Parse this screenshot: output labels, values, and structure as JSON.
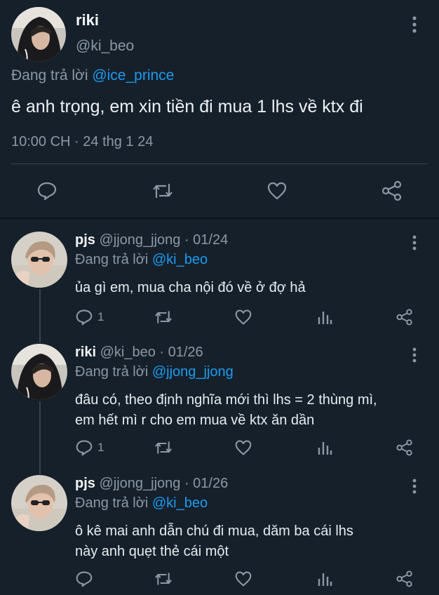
{
  "main_tweet": {
    "name": "riki",
    "handle": "@ki_beo",
    "replying_prefix": "Đang trả lời",
    "replying_to": "@ice_prince",
    "text": "ê anh trọng, em xin tiền đi mua 1 lhs về ktx đi",
    "timestamp": "10:00 CH · 24 thg 1 24",
    "actions": [
      "reply-icon",
      "retweet-icon",
      "like-icon",
      "share-icon"
    ]
  },
  "replies": [
    {
      "name": "pjs",
      "handle_date": "@jjong_jjong · 01/24",
      "replying_prefix": "Đang trả lời",
      "replying_to": "@ki_beo",
      "text": "ủa gì em, mua cha nội đó về ở đợ hả",
      "reply_count": "1"
    },
    {
      "name": "riki",
      "handle_date": "@ki_beo · 01/26",
      "replying_prefix": "Đang trả lời",
      "replying_to": "@jjong_jjong",
      "text": "đâu có, theo định nghĩa mới thì lhs = 2 thùng mì,\nem hết mì r cho em mua về ktx ăn dần",
      "reply_count": "1"
    },
    {
      "name": "pjs",
      "handle_date": "@jjong_jjong · 01/26",
      "replying_prefix": "Đang trả lời",
      "replying_to": "@ki_beo",
      "text": "ô kê mai anh dẫn chú đi mua, dăm ba cái lhs\nnày anh quẹt thẻ cái một",
      "reply_count": ""
    }
  ],
  "colors": {
    "background": "#15202b",
    "text": "#e7ecf0",
    "muted": "#8b98a5",
    "link": "#1d9bf0",
    "divider": "#38444d"
  }
}
